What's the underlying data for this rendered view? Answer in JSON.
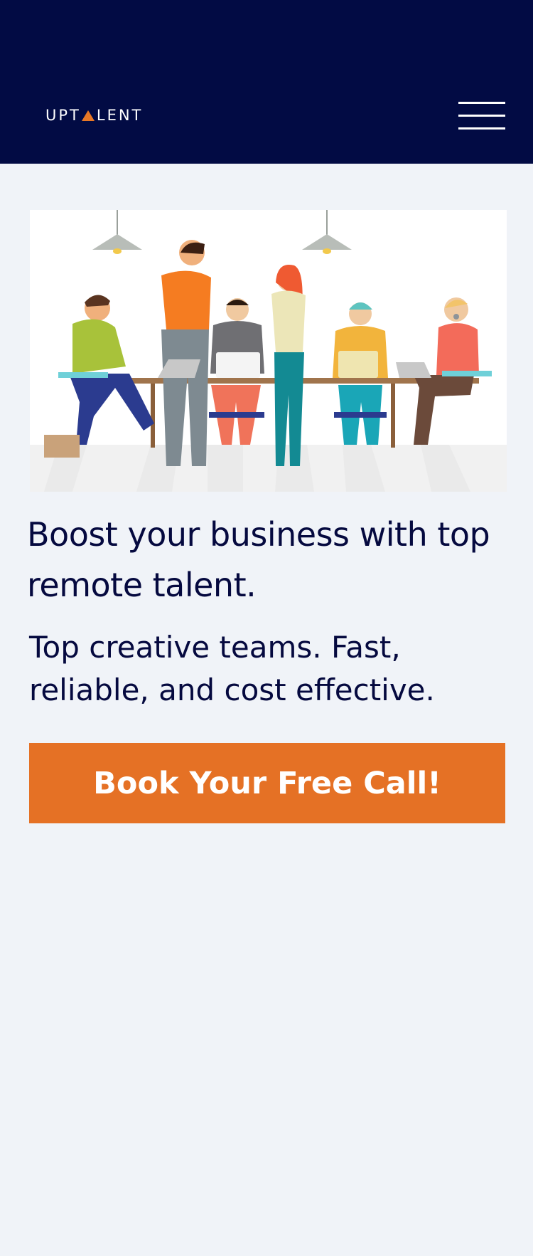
{
  "header": {
    "logo_left": "UPT",
    "logo_right": "LENT",
    "menu_icon": "hamburger-menu-icon"
  },
  "hero": {
    "image_icon": "team-working-illustration",
    "headline": "Boost your business with top remote talent.",
    "subheadline": "Top creative teams. Fast, reliable, and cost effective.",
    "cta_label": "Book Your Free Call!"
  },
  "colors": {
    "header_bg": "#020b44",
    "page_bg": "#f0f3f8",
    "accent": "#e57125",
    "text": "#05093f"
  }
}
